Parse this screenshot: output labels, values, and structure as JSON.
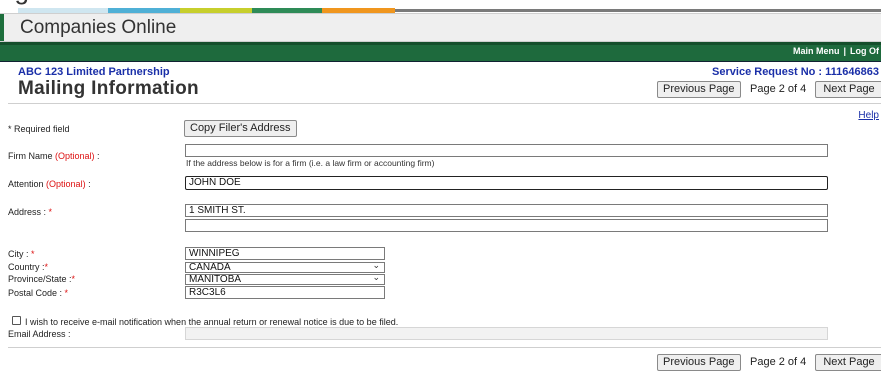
{
  "header": {
    "title": "Companies Online"
  },
  "topnav": {
    "main_menu": "Main Menu",
    "separator": "|",
    "log_off": "Log Of"
  },
  "context": {
    "organization": "ABC 123 Limited Partnership",
    "service_request": "Service Request No : 111646863"
  },
  "page": {
    "title": "Mailing Information"
  },
  "pagination": {
    "previous": "Previous Page",
    "info": "Page 2 of 4",
    "next": "Next Page"
  },
  "help": {
    "label": "Help"
  },
  "form": {
    "required_note": "* Required field",
    "copy_button": "Copy Filer's Address",
    "firm_name": {
      "label": "Firm Name",
      "optional": "(Optional)",
      "colon": " :",
      "value": "",
      "hint": "If the address below is for a firm (i.e. a law firm or accounting firm)"
    },
    "attention": {
      "label": "Attention",
      "optional": "(Optional)",
      "colon": " :",
      "value": "JOHN DOE"
    },
    "address": {
      "label": "Address : ",
      "req": "*",
      "line1": "1 SMITH ST.",
      "line2": ""
    },
    "city": {
      "label": "City : ",
      "req": "*",
      "value": "WINNIPEG"
    },
    "country": {
      "label": "Country :",
      "req": "*",
      "value": "CANADA"
    },
    "province": {
      "label": "Province/State :",
      "req": "*",
      "value": "MANITOBA"
    },
    "postal": {
      "label": "Postal Code : ",
      "req": "*",
      "value": "R3C3L6"
    },
    "email_notify": {
      "label": "I wish to receive e-mail notification when the annual return or renewal notice is due to be filed.",
      "checked": false
    },
    "email": {
      "label": "Email Address :",
      "value": ""
    }
  },
  "colors": {
    "header_green": "#1e6a3d",
    "link_blue": "#1a2fa8",
    "required_red": "#d11111",
    "bar_segments": [
      "#4fb0d6",
      "#c7cf2c",
      "#2e8b57",
      "#1e8a9a",
      "#f0961e"
    ]
  }
}
